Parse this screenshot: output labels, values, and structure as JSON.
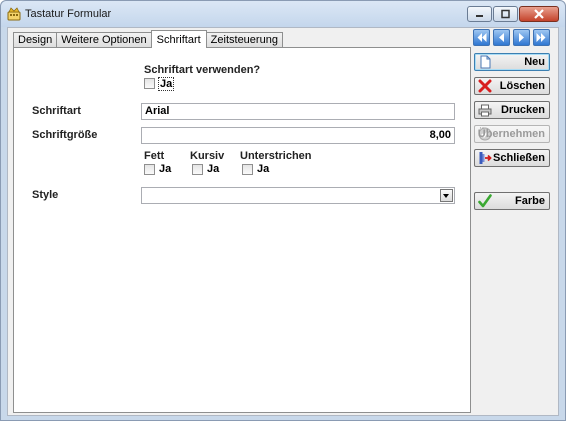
{
  "window": {
    "title": "Tastatur Formular"
  },
  "tabs": [
    {
      "label": "Design"
    },
    {
      "label": "Weitere Optionen"
    },
    {
      "label": "Schriftart"
    },
    {
      "label": "Zeitsteuerung"
    }
  ],
  "form": {
    "use_font_label": "Schriftart verwenden?",
    "use_font_check": "Ja",
    "font_label": "Schriftart",
    "font_value": "Arial",
    "size_label": "Schriftgröße",
    "size_value": "8,00",
    "bold_label": "Fett",
    "bold_check": "Ja",
    "italic_label": "Kursiv",
    "italic_check": "Ja",
    "underline_label": "Unterstrichen",
    "underline_check": "Ja",
    "style_label": "Style",
    "style_value": ""
  },
  "buttons": {
    "new": "Neu",
    "delete": "Löschen",
    "print": "Drucken",
    "apply": "Übernehmen",
    "close": "Schließen",
    "color": "Farbe"
  },
  "icons": {
    "app": "keyboard-crown-icon",
    "nav": [
      "first-record-icon",
      "previous-record-icon",
      "next-record-icon",
      "last-record-icon"
    ]
  },
  "colors": {
    "nav_blue": "#2f77d2",
    "delete_red": "#d81e1e",
    "check_green": "#3aa832",
    "tab_border": "#8e8f8f"
  }
}
